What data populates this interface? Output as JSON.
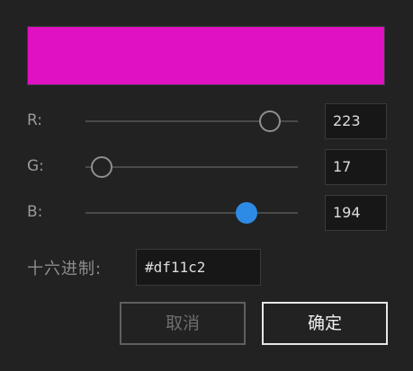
{
  "colors": {
    "preview": "#df11c2",
    "accent_thumb": "#2e8be5"
  },
  "red": {
    "label": "R:",
    "value": "223",
    "fraction": 0.874
  },
  "green": {
    "label": "G:",
    "value": "17",
    "fraction": 0.067
  },
  "blue": {
    "label": "B:",
    "value": "194",
    "fraction": 0.761
  },
  "hex": {
    "label": "十六进制:",
    "value": "#df11c2"
  },
  "buttons": {
    "cancel": "取消",
    "ok": "确定"
  }
}
